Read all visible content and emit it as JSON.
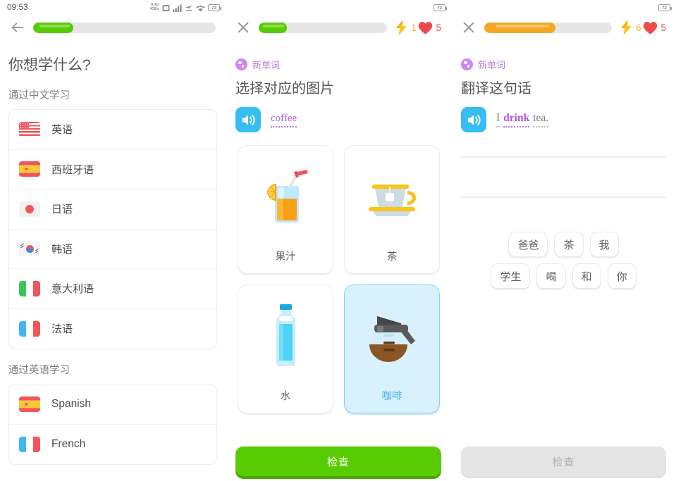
{
  "status_bar": {
    "time": "09:53",
    "net_rate_value": "0.10",
    "net_rate_unit": "KB/s",
    "battery_level": "72",
    "icons": [
      "net-rate-icon",
      "sim-icon",
      "signal-bars-icon",
      "data-arrows-icon",
      "wifi-icon",
      "battery-icon"
    ]
  },
  "screens": {
    "course_picker": {
      "back_icon": "back-arrow-icon",
      "progress_percent": 22,
      "progress_color": "#58cc02",
      "title": "你想学什么?",
      "sections": [
        {
          "label": "通过中文学习",
          "items": [
            {
              "flag": "us-flag-icon",
              "label": "英语"
            },
            {
              "flag": "spain-flag-icon",
              "label": "西班牙语"
            },
            {
              "flag": "japan-flag-icon",
              "label": "日语"
            },
            {
              "flag": "korea-flag-icon",
              "label": "韩语"
            },
            {
              "flag": "italy-flag-icon",
              "label": "意大利语"
            },
            {
              "flag": "france-flag-icon",
              "label": "法语"
            }
          ]
        },
        {
          "label": "通过英语学习",
          "items": [
            {
              "flag": "spain-flag-icon",
              "label": "Spanish"
            },
            {
              "flag": "france-flag-icon",
              "label": "French"
            }
          ]
        }
      ]
    },
    "pick_picture": {
      "close_icon": "close-x-icon",
      "progress_percent": 22,
      "progress_color": "#58cc02",
      "streak": {
        "icon": "lightning-bolt-icon",
        "value": "1",
        "color": "#f0b323"
      },
      "hearts": {
        "icon": "heart-icon",
        "value": "5",
        "color": "#ef4a4a"
      },
      "badge": {
        "icon": "new-word-badge-icon",
        "label": "新单词",
        "color": "#c07ae0"
      },
      "title": "选择对应的图片",
      "prompt": {
        "speaker_icon": "speaker-icon",
        "word": "coffee"
      },
      "options": [
        {
          "art": "juice-glass-icon",
          "label": "果汁",
          "selected": false
        },
        {
          "art": "teacup-icon",
          "label": "茶",
          "selected": false
        },
        {
          "art": "water-bottle-icon",
          "label": "水",
          "selected": false
        },
        {
          "art": "coffee-pot-icon",
          "label": "咖啡",
          "selected": true
        }
      ],
      "check_label": "检查",
      "check_enabled": true
    },
    "translate_sentence": {
      "close_icon": "close-x-icon",
      "progress_percent": 56,
      "progress_color": "#f5a623",
      "streak": {
        "icon": "lightning-bolt-icon",
        "value": "6",
        "color": "#f0b323"
      },
      "hearts": {
        "icon": "heart-icon",
        "value": "5",
        "color": "#ef4a4a"
      },
      "badge": {
        "icon": "new-word-badge-icon",
        "label": "新单词",
        "color": "#c07ae0"
      },
      "title": "翻译这句话",
      "prompt": {
        "speaker_icon": "speaker-icon",
        "tokens": [
          {
            "text": "I",
            "highlighted": false
          },
          {
            "text": "drink",
            "highlighted": true
          },
          {
            "text": "tea.",
            "highlighted": false
          }
        ]
      },
      "answer_lines": 2,
      "word_bank_rows": [
        [
          "爸爸",
          "茶",
          "我"
        ],
        [
          "学生",
          "喝",
          "和",
          "你"
        ]
      ],
      "check_label": "检查",
      "check_enabled": false
    }
  }
}
